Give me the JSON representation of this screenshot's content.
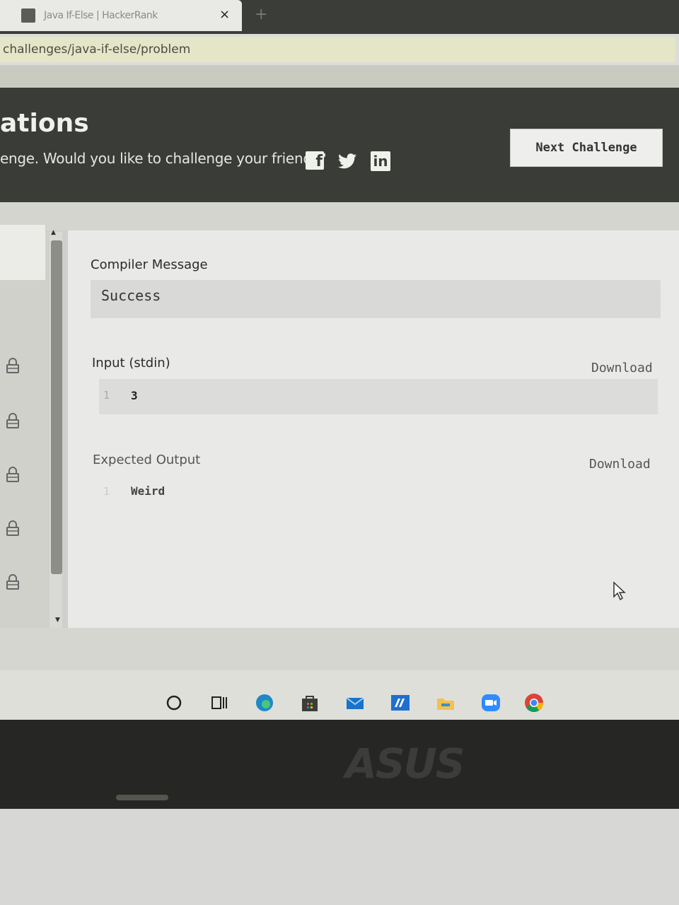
{
  "browser": {
    "tab_title": "Java If-Else | HackerRank",
    "tab_close": "×",
    "new_tab": "+",
    "url": "challenges/java-if-else/problem"
  },
  "banner": {
    "title": "ations",
    "subtitle": "enge. Would you like to challenge your friends?",
    "next_button": "Next Challenge",
    "share_icons": [
      "facebook-icon",
      "twitter-icon",
      "linkedin-icon"
    ]
  },
  "results": {
    "compiler_label": "Compiler Message",
    "compiler_message": "Success",
    "input_label": "Input (stdin)",
    "input_download": "Download",
    "input_line_no": "1",
    "input_value": "3",
    "expected_label": "Expected Output",
    "expected_download": "Download",
    "expected_line_no": "1",
    "expected_value": "Weird"
  },
  "sidebar": {
    "lock_icon": "lock-icon"
  },
  "taskbar": {
    "icons": [
      "search-circle-icon",
      "task-view-icon",
      "edge-icon",
      "store-icon",
      "mail-icon",
      "app-icon",
      "file-explorer-icon",
      "zoom-icon",
      "chrome-icon"
    ]
  },
  "bezel": {
    "logo": "ASUS"
  },
  "colors": {
    "banner_bg": "#3a3c37",
    "content_bg": "#e9e9e7"
  }
}
